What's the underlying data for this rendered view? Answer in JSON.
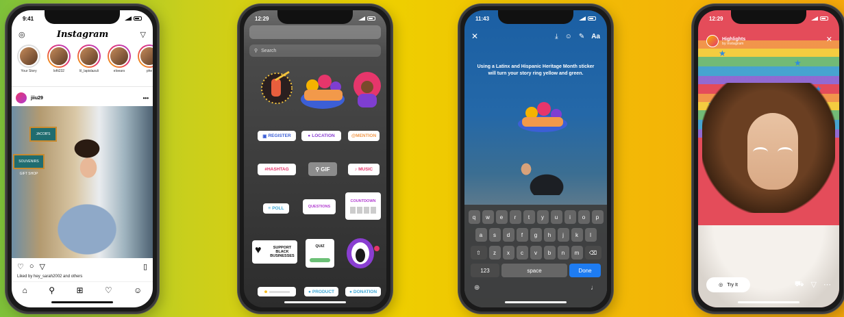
{
  "phone1": {
    "time": "9:41",
    "app_title": "Instagram",
    "stories": [
      {
        "label": "Your Story"
      },
      {
        "label": "lofti232"
      },
      {
        "label": "lil_lapislazuli"
      },
      {
        "label": "eloears"
      },
      {
        "label": "phe"
      }
    ],
    "post_user": "jiiu29",
    "post_signs": [
      "JACOB'S",
      "SOUVENIRS GIFT SHOP"
    ],
    "liked_by": "Liked by hey_sarah2002 and others"
  },
  "phone2": {
    "time": "12:29",
    "search_placeholder": "Search",
    "stickers": {
      "register": "REGISTER",
      "location": "LOCATION",
      "mention": "@MENTION",
      "hashtag": "#HASHTAG",
      "gif": "GIF",
      "music": "MUSIC",
      "poll": "POLL",
      "questions": "QUESTIONS",
      "countdown": "COUNTDOWN",
      "support": "SUPPORT BLACK BUSINESSES",
      "quiz": "QUIZ",
      "product": "PRODUCT",
      "donation": "DONATION"
    }
  },
  "phone3": {
    "time": "11:43",
    "tool_text": "Aa",
    "caption": "Using a Latinx and Hispanic Heritage Month sticker will turn your story ring yellow and green.",
    "keys_row1": [
      "q",
      "w",
      "e",
      "r",
      "t",
      "y",
      "u",
      "i",
      "o",
      "p"
    ],
    "keys_row2": [
      "a",
      "s",
      "d",
      "f",
      "g",
      "h",
      "j",
      "k",
      "l"
    ],
    "keys_row3": [
      "z",
      "x",
      "c",
      "v",
      "b",
      "n",
      "m"
    ],
    "key_123": "123",
    "key_space": "space",
    "key_done": "Done"
  },
  "phone4": {
    "time": "12:29",
    "highlight_title": "Highlights",
    "highlight_sub": "by instagram",
    "try_it": "Try It"
  }
}
